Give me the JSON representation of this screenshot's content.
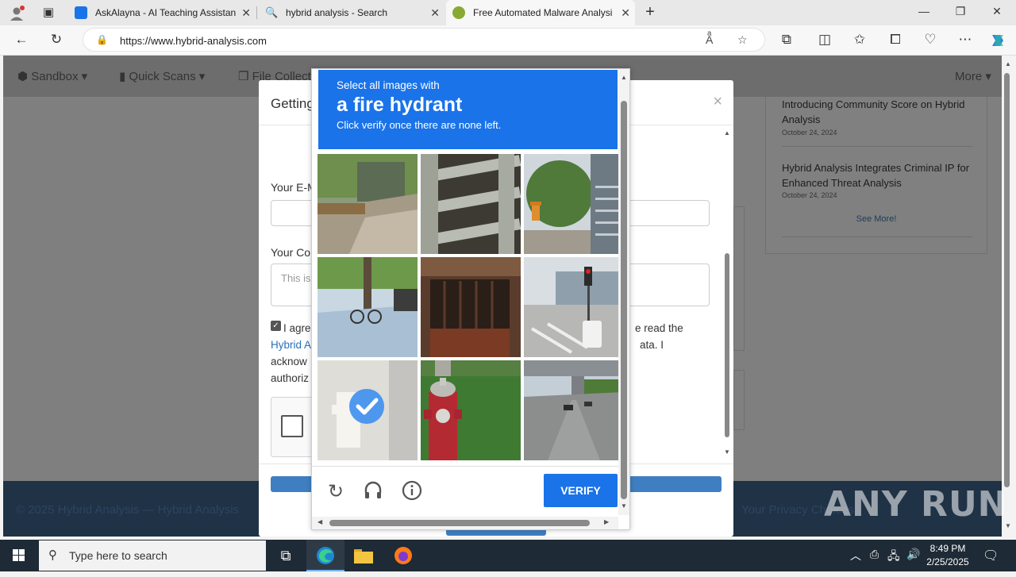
{
  "browser": {
    "tabs": [
      {
        "title": "AskAlayna - AI Teaching Assistan",
        "active": false
      },
      {
        "title": "hybrid analysis - Search",
        "active": false
      },
      {
        "title": "Free Automated Malware Analysi",
        "active": true
      }
    ],
    "url": "https://www.hybrid-analysis.com"
  },
  "site": {
    "nav": [
      "Sandbox",
      "Quick Scans",
      "File Collections"
    ],
    "nav_more": "More",
    "news": [
      {
        "title": "Introducing Community Score on Hybrid Analysis",
        "date": "October 24, 2024"
      },
      {
        "title": "Hybrid Analysis Integrates Criminal IP for Enhanced Threat Analysis",
        "date": "October 24, 2024"
      }
    ],
    "see_more": "See More!",
    "footer_left": "© 2025 Hybrid Analysis — Hybrid Analysis",
    "footer_right": "Your Privacy Choices"
  },
  "modal": {
    "title": "Getting Started",
    "email_label": "Your E-Mail",
    "comment_label": "Your Comment",
    "comment_placeholder": "This is",
    "agree_text_1": "I agree",
    "agree_text_2": "e read the",
    "agree_link": "Hybrid A",
    "agree_text_3": "ata. I",
    "agree_text_4": "acknow",
    "agree_text_5": "authoriz"
  },
  "captcha": {
    "line1": "Select all images with",
    "line2": "a fire hydrant",
    "line3": "Click verify once there are none left.",
    "verify": "VERIFY",
    "tiles": [
      {
        "name": "tile-street-sidewalk",
        "selected": false
      },
      {
        "name": "tile-wooden-fence",
        "selected": false
      },
      {
        "name": "tile-building-hydrant",
        "selected": false
      },
      {
        "name": "tile-bicycle-street",
        "selected": false
      },
      {
        "name": "tile-metal-gate",
        "selected": false
      },
      {
        "name": "tile-intersection-traffic-light",
        "selected": false
      },
      {
        "name": "tile-white-hydrant",
        "selected": true
      },
      {
        "name": "tile-red-hydrant",
        "selected": false
      },
      {
        "name": "tile-highway-bridge",
        "selected": false
      }
    ]
  },
  "watermark": "ANY RUN",
  "taskbar": {
    "search_placeholder": "Type here to search",
    "time": "8:49 PM",
    "date": "2/25/2025"
  }
}
